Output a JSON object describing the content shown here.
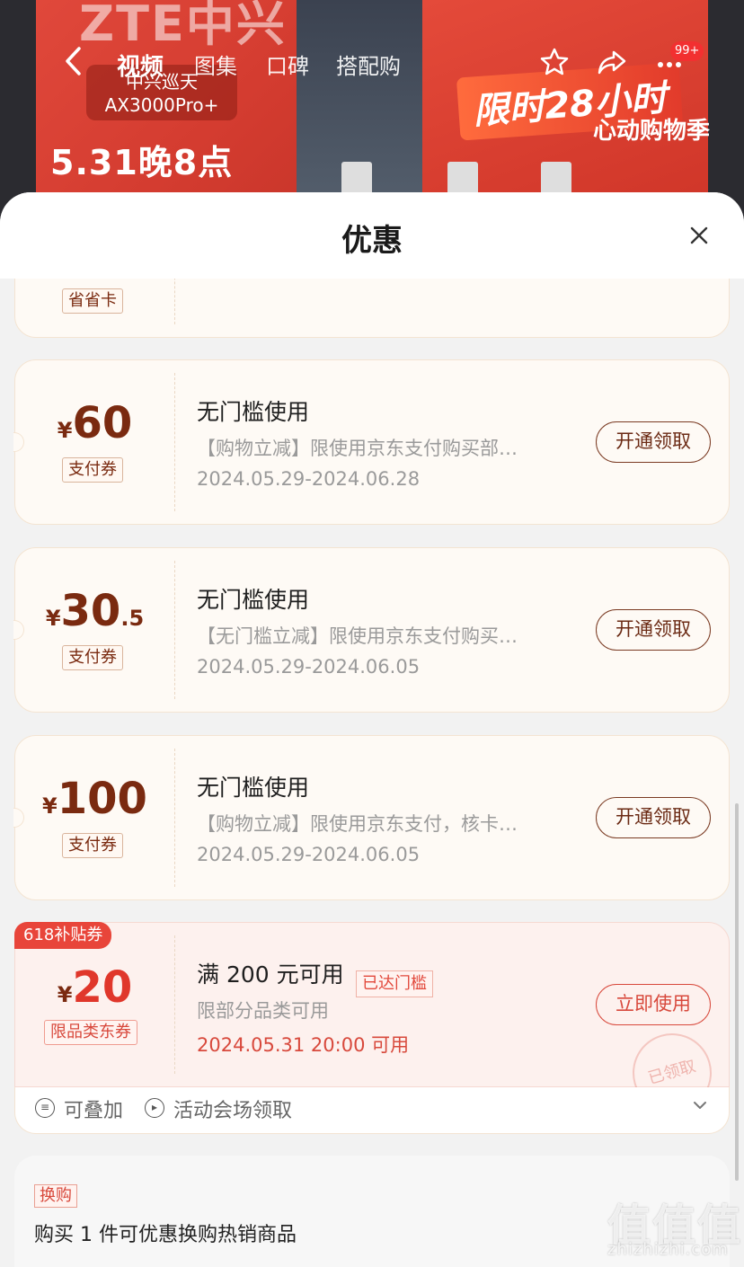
{
  "banner": {
    "brand": "ZTE中兴",
    "model_line1": "中兴巡天",
    "model_line2": "AX3000Pro+",
    "promo_date": "5.31晚8点",
    "limited_time": "限时28小时",
    "festival": "心动购物季"
  },
  "nav": {
    "back_icon": "chevron-left-icon",
    "tabs": [
      "视频",
      "图集",
      "口碑",
      "搭配购"
    ],
    "active_tab": "视频",
    "badge": "99+"
  },
  "sheet": {
    "title": "优惠",
    "close_glyph": "×"
  },
  "partial_coupon": {
    "type_label": "省省卡"
  },
  "coupons": [
    {
      "currency": "¥",
      "amount_int": "60",
      "amount_dec": "",
      "type_label": "支付券",
      "title": "无门槛使用",
      "desc": "【购物立减】限使用京东支付购买部…",
      "date": "2024.05.29-2024.06.28",
      "button": "开通领取"
    },
    {
      "currency": "¥",
      "amount_int": "30",
      "amount_dec": ".5",
      "type_label": "支付券",
      "title": "无门槛使用",
      "desc": "【无门槛立减】限使用京东支付购买…",
      "date": "2024.05.29-2024.06.05",
      "button": "开通领取"
    },
    {
      "currency": "¥",
      "amount_int": "100",
      "amount_dec": "",
      "type_label": "支付券",
      "title": "无门槛使用",
      "desc": "【购物立减】限使用京东支付，核卡…",
      "date": "2024.05.29-2024.06.05",
      "button": "开通领取"
    }
  ],
  "special_coupon": {
    "badge": "618补贴券",
    "currency": "¥",
    "amount_int": "20",
    "type_label": "限品类东券",
    "title": "满 200 元可用",
    "reached": "已达门槛",
    "desc": "限部分品类可用",
    "date": "2024.05.31 20:00 可用",
    "button": "立即使用",
    "stamp": "已领取",
    "features": [
      "可叠加",
      "活动会场领取"
    ]
  },
  "swap": {
    "tag": "换购",
    "text": "购买 1 件可优惠换购热销商品"
  },
  "watermark": {
    "main": "值值值",
    "sub": "zhizhizhi.com"
  },
  "colors": {
    "accent_red": "#d8493c",
    "coupon_brown": "#7a2a10",
    "coupon_bg": "#fefaf5"
  }
}
